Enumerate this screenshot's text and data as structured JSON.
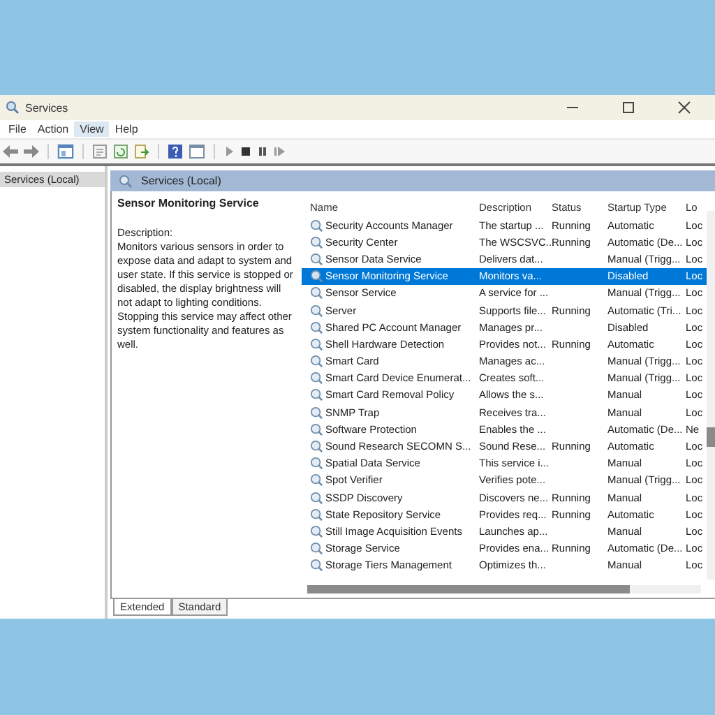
{
  "window": {
    "title": "Services"
  },
  "menu": [
    {
      "label": "File",
      "selected": false
    },
    {
      "label": "Action",
      "selected": false
    },
    {
      "label": "View",
      "selected": true
    },
    {
      "label": "Help",
      "selected": false
    }
  ],
  "tree": [
    {
      "label": "Services (Local)",
      "selected": true
    }
  ],
  "panel": {
    "title": "Services (Local)"
  },
  "detail": {
    "name": "Sensor Monitoring Service",
    "label": "Description:",
    "text": "Monitors various sensors in order to expose data and adapt to system and user state.  If this service is stopped or disabled, the display brightness will not adapt to lighting conditions. Stopping this service may affect other system functionality and features as well."
  },
  "table": {
    "columns": [
      "Name",
      "Description",
      "Status",
      "Startup Type",
      "Lo"
    ],
    "rows": [
      {
        "name": "Security Accounts Manager",
        "description": "The startup ...",
        "status": "Running",
        "startup": "Automatic",
        "logon": "Loc",
        "selected": false
      },
      {
        "name": "Security Center",
        "description": "The WSCSVC...",
        "status": "Running",
        "startup": "Automatic (De...",
        "logon": "Loc",
        "selected": false
      },
      {
        "name": "Sensor Data Service",
        "description": "Delivers dat...",
        "status": "",
        "startup": "Manual (Trigg...",
        "logon": "Loc",
        "selected": false
      },
      {
        "name": "Sensor Monitoring Service",
        "description": "Monitors va...",
        "status": "",
        "startup": "Disabled",
        "logon": "Loc",
        "selected": true
      },
      {
        "name": "Sensor Service",
        "description": "A service for ...",
        "status": "",
        "startup": "Manual (Trigg...",
        "logon": "Loc",
        "selected": false
      },
      {
        "name": "Server",
        "description": "Supports file...",
        "status": "Running",
        "startup": "Automatic (Tri...",
        "logon": "Loc",
        "selected": false
      },
      {
        "name": "Shared PC Account Manager",
        "description": "Manages pr...",
        "status": "",
        "startup": "Disabled",
        "logon": "Loc",
        "selected": false
      },
      {
        "name": "Shell Hardware Detection",
        "description": "Provides not...",
        "status": "Running",
        "startup": "Automatic",
        "logon": "Loc",
        "selected": false
      },
      {
        "name": "Smart Card",
        "description": "Manages ac...",
        "status": "",
        "startup": "Manual (Trigg...",
        "logon": "Loc",
        "selected": false
      },
      {
        "name": "Smart Card Device Enumerat...",
        "description": "Creates soft...",
        "status": "",
        "startup": "Manual (Trigg...",
        "logon": "Loc",
        "selected": false
      },
      {
        "name": "Smart Card Removal Policy",
        "description": "Allows the s...",
        "status": "",
        "startup": "Manual",
        "logon": "Loc",
        "selected": false
      },
      {
        "name": "SNMP Trap",
        "description": "Receives tra...",
        "status": "",
        "startup": "Manual",
        "logon": "Loc",
        "selected": false
      },
      {
        "name": "Software Protection",
        "description": "Enables the ...",
        "status": "",
        "startup": "Automatic (De...",
        "logon": "Ne",
        "selected": false
      },
      {
        "name": "Sound Research SECOMN S...",
        "description": "Sound Rese...",
        "status": "Running",
        "startup": "Automatic",
        "logon": "Loc",
        "selected": false
      },
      {
        "name": "Spatial Data Service",
        "description": "This service i...",
        "status": "",
        "startup": "Manual",
        "logon": "Loc",
        "selected": false
      },
      {
        "name": "Spot Verifier",
        "description": "Verifies pote...",
        "status": "",
        "startup": "Manual (Trigg...",
        "logon": "Loc",
        "selected": false
      },
      {
        "name": "SSDP Discovery",
        "description": "Discovers ne...",
        "status": "Running",
        "startup": "Manual",
        "logon": "Loc",
        "selected": false
      },
      {
        "name": "State Repository Service",
        "description": "Provides req...",
        "status": "Running",
        "startup": "Automatic",
        "logon": "Loc",
        "selected": false
      },
      {
        "name": "Still Image Acquisition Events",
        "description": "Launches ap...",
        "status": "",
        "startup": "Manual",
        "logon": "Loc",
        "selected": false
      },
      {
        "name": "Storage Service",
        "description": "Provides ena...",
        "status": "Running",
        "startup": "Automatic (De...",
        "logon": "Loc",
        "selected": false
      },
      {
        "name": "Storage Tiers Management",
        "description": "Optimizes th...",
        "status": "",
        "startup": "Manual",
        "logon": "Loc",
        "selected": false
      }
    ]
  },
  "tabs": [
    {
      "label": "Extended",
      "selected": true
    },
    {
      "label": "Standard",
      "selected": false
    }
  ]
}
